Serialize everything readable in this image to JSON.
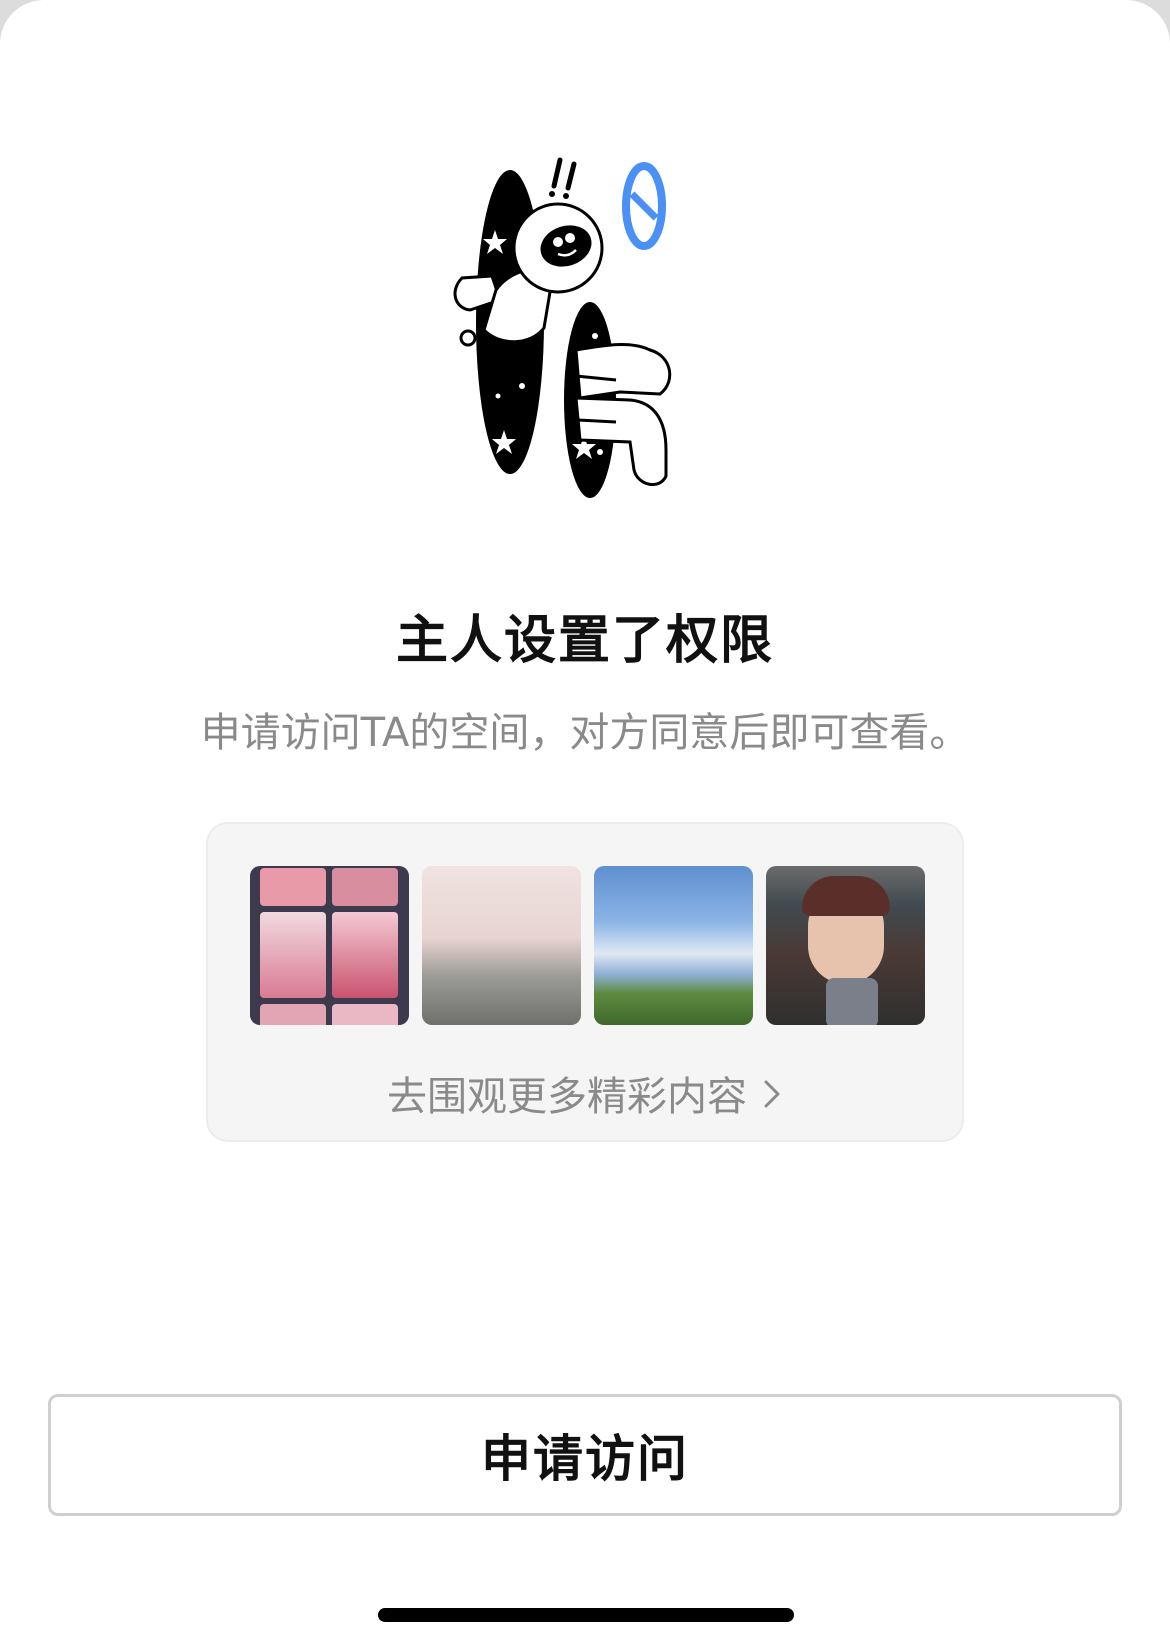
{
  "page": {
    "title": "主人设置了权限",
    "subtitle": "申请访问TA的空间，对方同意后即可查看。"
  },
  "recommend_card": {
    "thumbnails": [
      {
        "name": "anime-pink-collage-thumbnail"
      },
      {
        "name": "school-uniform-photo-thumbnail"
      },
      {
        "name": "sky-game-scene-thumbnail"
      },
      {
        "name": "selfie-portrait-thumbnail"
      }
    ],
    "more_label": "去围观更多精彩内容",
    "more_icon": "chevron-right-icon"
  },
  "actions": {
    "apply_label": "申请访问"
  },
  "colors": {
    "accent": "#4a90f5",
    "title": "#111111",
    "muted": "#8a8a8a",
    "card_bg": "#f5f5f5"
  }
}
